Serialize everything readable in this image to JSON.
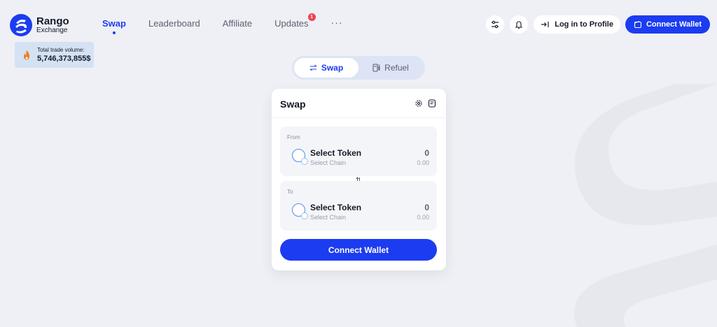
{
  "brand": {
    "title": "Rango",
    "subtitle": "Exchange"
  },
  "nav": [
    {
      "label": "Swap",
      "active": true
    },
    {
      "label": "Leaderboard"
    },
    {
      "label": "Affiliate"
    },
    {
      "label": "Updates",
      "badge": "1"
    }
  ],
  "nav_more": "···",
  "header": {
    "login_label": "Log in to Profile",
    "connect_label": "Connect Wallet"
  },
  "volume": {
    "label": "Total trade volume:",
    "value": "5,746,373,855$"
  },
  "tabs": [
    {
      "label": "Swap",
      "active": true
    },
    {
      "label": "Refuel"
    }
  ],
  "card": {
    "title": "Swap",
    "from": {
      "label": "From",
      "token": "Select Token",
      "chain": "Select Chain",
      "amount": "0",
      "usd": "0.00"
    },
    "to": {
      "label": "To",
      "token": "Select Token",
      "chain": "Select Chain",
      "amount": "0",
      "usd": "0.00"
    },
    "connect_label": "Connect Wallet"
  },
  "colors": {
    "accent": "#1c3cf1",
    "background": "#eef0f5",
    "badge": "#f2404f",
    "volume_bg": "#d5e2f4"
  }
}
